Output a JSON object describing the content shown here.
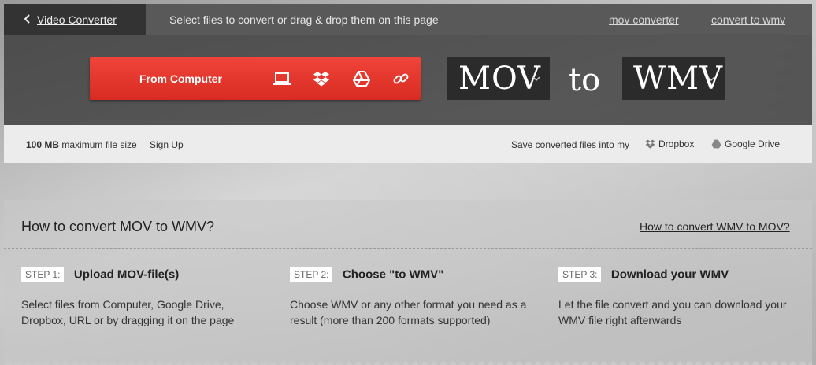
{
  "topbar": {
    "back_label": "Video Converter",
    "hint": "Select files to convert or drag & drop them on this page",
    "link_mov": "mov converter",
    "link_wmv": "convert to wmv"
  },
  "converter": {
    "from_button": "From Computer",
    "source_icons": [
      "laptop-icon",
      "dropbox-icon",
      "google-drive-icon",
      "link-icon"
    ],
    "from_format": "MOV",
    "to_word": "to",
    "to_format": "WMV",
    "accent_color": "#e23a30"
  },
  "infobar": {
    "size_strong": "100 MB",
    "size_text": "maximum file size",
    "signup": "Sign Up",
    "save_label": "Save converted files into my",
    "dropbox": "Dropbox",
    "gdrive": "Google Drive"
  },
  "howto": {
    "title": "How to convert MOV to WMV?",
    "reverse_link": "How to convert WMV to MOV?",
    "steps": [
      {
        "badge": "STEP 1:",
        "title": "Upload MOV-file(s)",
        "desc": "Select files from Computer, Google Drive, Dropbox, URL or by dragging it on the page"
      },
      {
        "badge": "STEP 2:",
        "title": "Choose \"to WMV\"",
        "desc": "Choose WMV or any other format you need as a result (more than 200 formats supported)"
      },
      {
        "badge": "STEP 3:",
        "title": "Download your WMV",
        "desc": "Let the file convert and you can download your WMV file right afterwards"
      }
    ]
  }
}
